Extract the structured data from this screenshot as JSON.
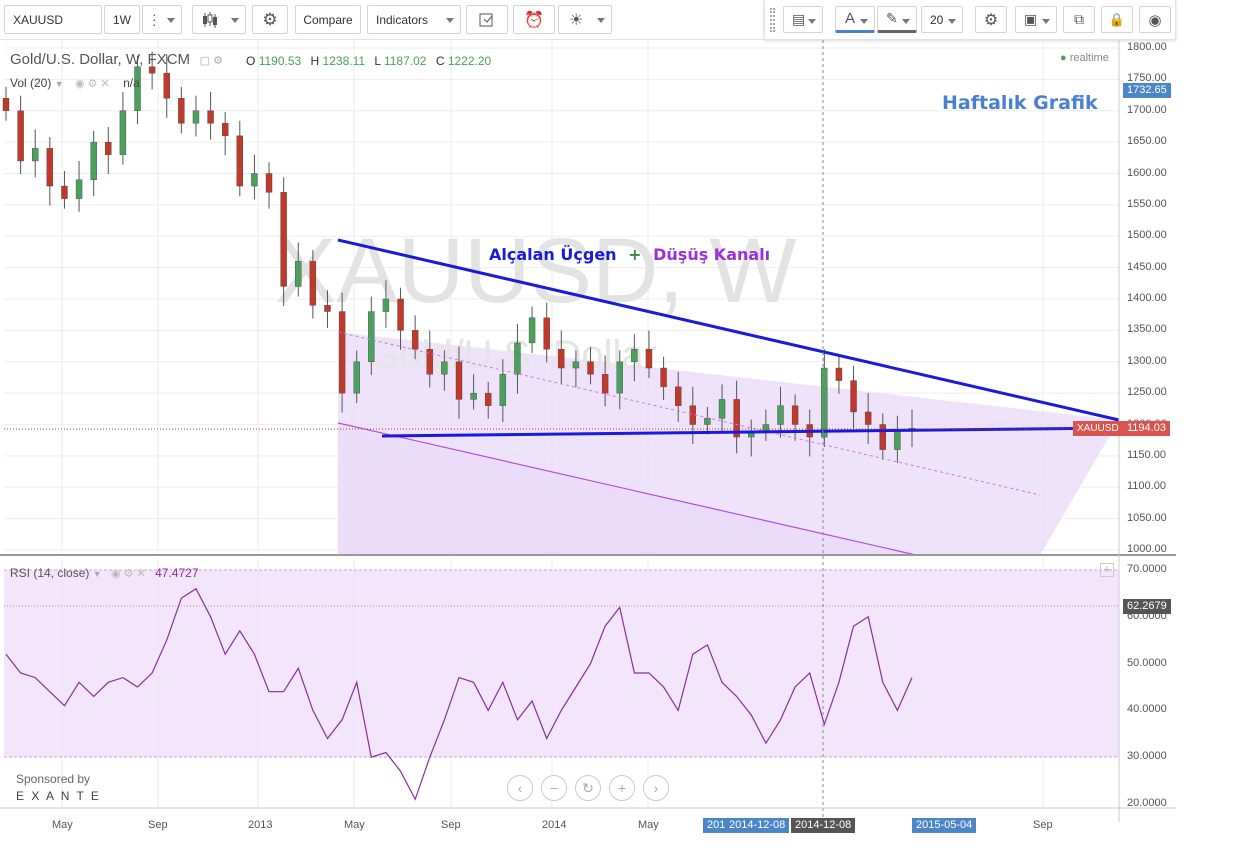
{
  "toolbar": {
    "symbol": "XAUUSD",
    "interval": "1W",
    "compare_label": "Compare",
    "indicators_label": "Indicators"
  },
  "toolbar2": {
    "font_size": "20"
  },
  "legend": {
    "title": "Gold/U.S. Dollar, W, FXCM",
    "o_label": "O",
    "o": "1190.53",
    "h_label": "H",
    "h": "1238.11",
    "l_label": "L",
    "l": "1187.02",
    "c_label": "C",
    "c": "1222.20",
    "vol": "Vol (20)",
    "vol_value": "n/a",
    "realtime": "realtime"
  },
  "watermark": {
    "big": "XAUUSD, W",
    "small": "Gold/U.S. Dollar"
  },
  "annotations": {
    "heading": "Haftalık Grafik",
    "triangle": "Alçalan Üçgen",
    "plus": "+",
    "channel": "Düşüş Kanalı"
  },
  "price_axis": {
    "ticks": [
      "1800.00",
      "1750.00",
      "1700.00",
      "1650.00",
      "1600.00",
      "1550.00",
      "1500.00",
      "1450.00",
      "1400.00",
      "1350.00",
      "1300.00",
      "1250.00",
      "1200.00",
      "1150.00",
      "1100.00",
      "1050.00",
      "1000.00"
    ],
    "top_tag": "1732.65",
    "symbol_tag": "XAUUSD",
    "last_tag": "1194.03"
  },
  "rsi": {
    "label": "RSI (14, close)",
    "value": "47.4727",
    "ticks": [
      "70.0000",
      "60.0000",
      "50.0000",
      "40.0000",
      "30.0000",
      "20.0000"
    ],
    "tag": "62.2679"
  },
  "time_axis": {
    "labels": [
      "May",
      "Sep",
      "2013",
      "May",
      "Sep",
      "2014",
      "May",
      "Sep"
    ],
    "tag1": "2014-12-08",
    "tag1_partial": "201",
    "tag2": "2014-12-08",
    "tag3": "2015-05-04"
  },
  "sponsor": {
    "line1": "Sponsored by",
    "line2": "E X A N T E"
  },
  "colors": {
    "up": "#4aa05c",
    "down": "#c0392b",
    "trend": "#1a1adb",
    "channel": "#9b30d9",
    "channel_fill": "#ead9fa",
    "rsi": "#8a2d9e",
    "heading": "#4a7fd4"
  },
  "chart_data": {
    "type": "candlestick",
    "series": [
      {
        "name": "XAUUSD",
        "close": [
          1700,
          1620,
          1640,
          1580,
          1560,
          1590,
          1650,
          1630,
          1700,
          1770,
          1760,
          1720,
          1680,
          1700,
          1680,
          1660,
          1580,
          1600,
          1570,
          1420,
          1460,
          1390,
          1380,
          1250,
          1300,
          1380,
          1400,
          1350,
          1320,
          1280,
          1300,
          1240,
          1250,
          1230,
          1280,
          1330,
          1370,
          1320,
          1290,
          1300,
          1280,
          1250,
          1300,
          1320,
          1290,
          1260,
          1230,
          1200,
          1210,
          1240,
          1180,
          1190,
          1200,
          1230,
          1200,
          1180,
          1290,
          1270,
          1220,
          1200,
          1160,
          1190,
          1194
        ]
      }
    ],
    "rsi": [
      52,
      48,
      47,
      44,
      41,
      46,
      43,
      46,
      47,
      45,
      48,
      55,
      64,
      66,
      60,
      52,
      57,
      52,
      44,
      44,
      49,
      40,
      34,
      38,
      46,
      30,
      31,
      27,
      21,
      30,
      38,
      47,
      46,
      40,
      46,
      38,
      42,
      34,
      40,
      45,
      50,
      58,
      62,
      48,
      48,
      45,
      40,
      52,
      54,
      46,
      43,
      39,
      33,
      38,
      45,
      48,
      37,
      46,
      58,
      60,
      46,
      40,
      47
    ],
    "ylim": [
      1000,
      1800
    ],
    "rsi_ylim": [
      20,
      70
    ]
  }
}
